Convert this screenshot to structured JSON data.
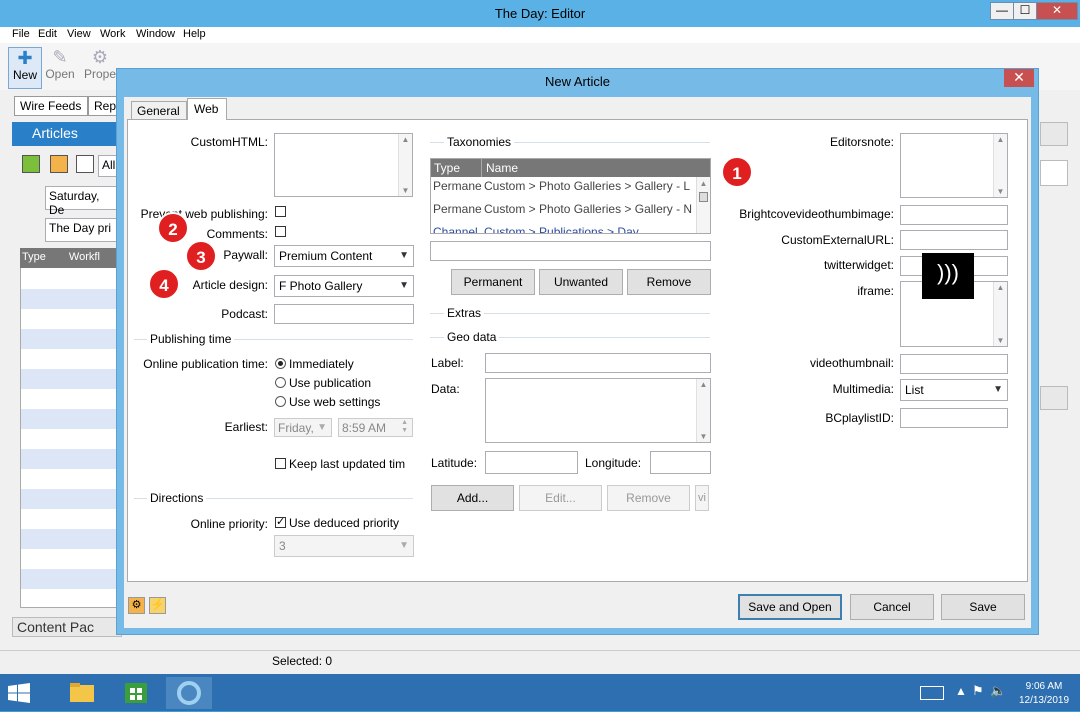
{
  "main_window": {
    "title": "The Day: Editor",
    "controls": {
      "minimize": "—",
      "maximize": "☐",
      "close": "✕"
    },
    "menu": [
      "File",
      "Edit",
      "View",
      "Work",
      "Window",
      "Help"
    ],
    "toolbar": {
      "new": "New",
      "open": "Open",
      "properties": "Prope"
    },
    "tabs": [
      "Wire Feeds",
      "Rep"
    ],
    "articles_panel": {
      "header": "Articles",
      "filter_value": "All",
      "date_value": "Saturday, De",
      "publication_value": "The Day pri",
      "grid_headers": [
        "Type",
        "Workfl"
      ]
    },
    "content_packages": "Content Pac",
    "status": "Selected: 0"
  },
  "dialog": {
    "title": "New Article",
    "close": "✕",
    "tabs": [
      "General",
      "Web"
    ],
    "left": {
      "custom_html_label": "CustomHTML:",
      "prevent_web_label": "Prevent web publishing:",
      "comments_label": "Comments:",
      "paywall_label": "Paywall:",
      "paywall_value": "Premium Content",
      "article_design_label": "Article design:",
      "article_design_value": "F Photo Gallery",
      "podcast_label": "Podcast:",
      "publishing_time_title": "Publishing time",
      "online_pub_label": "Online publication time:",
      "radio_immediately": "Immediately",
      "radio_use_publication": "Use publication",
      "radio_use_web_settings": "Use web settings",
      "earliest_label": "Earliest:",
      "earliest_date": "Friday,",
      "earliest_time": "8:59 AM",
      "keep_last_label": "Keep last updated tim",
      "directions_title": "Directions",
      "online_priority_label": "Online priority:",
      "use_deduced_label": "Use deduced priority",
      "priority_value": "3"
    },
    "middle": {
      "taxonomies_title": "Taxonomies",
      "grid_headers": [
        "Type",
        "Name"
      ],
      "rows": [
        {
          "type": "Permane",
          "name": "Custom > Photo Galleries > Gallery - L"
        },
        {
          "type": "Permane",
          "name": "Custom > Photo Galleries > Gallery - N"
        },
        {
          "type": "Channel",
          "name": "Custom > Publications > Day"
        }
      ],
      "btn_permanent": "Permanent",
      "btn_unwanted": "Unwanted",
      "btn_remove": "Remove",
      "extras_title": "Extras",
      "geo_title": "Geo data",
      "label_label": "Label:",
      "data_label": "Data:",
      "latitude_label": "Latitude:",
      "longitude_label": "Longitude:",
      "btn_add": "Add...",
      "btn_edit": "Edit...",
      "btn_remove2": "Remove",
      "btn_vi": "vi"
    },
    "right": {
      "editorsnote_label": "Editorsnote:",
      "brightcove_label": "Brightcovevideothumbimage:",
      "custom_external_label": "CustomExternalURL:",
      "twitter_label": "twitterwidget:",
      "iframe_label": "iframe:",
      "videothumb_label": "videothumbnail:",
      "multimedia_label": "Multimedia:",
      "multimedia_value": "List",
      "bcplaylist_label": "BCplaylistID:"
    },
    "footer": {
      "save_and_open": "Save and Open",
      "cancel": "Cancel",
      "save": "Save"
    },
    "callouts": [
      "1",
      "2",
      "3",
      "4"
    ]
  },
  "taskbar": {
    "time": "9:06 AM",
    "date": "12/13/2019"
  },
  "colors": {
    "titlebar": "#59b1e6",
    "dialog_frame": "#76bbe8",
    "callout": "#e02020",
    "taskbar": "#2d6fb0"
  }
}
